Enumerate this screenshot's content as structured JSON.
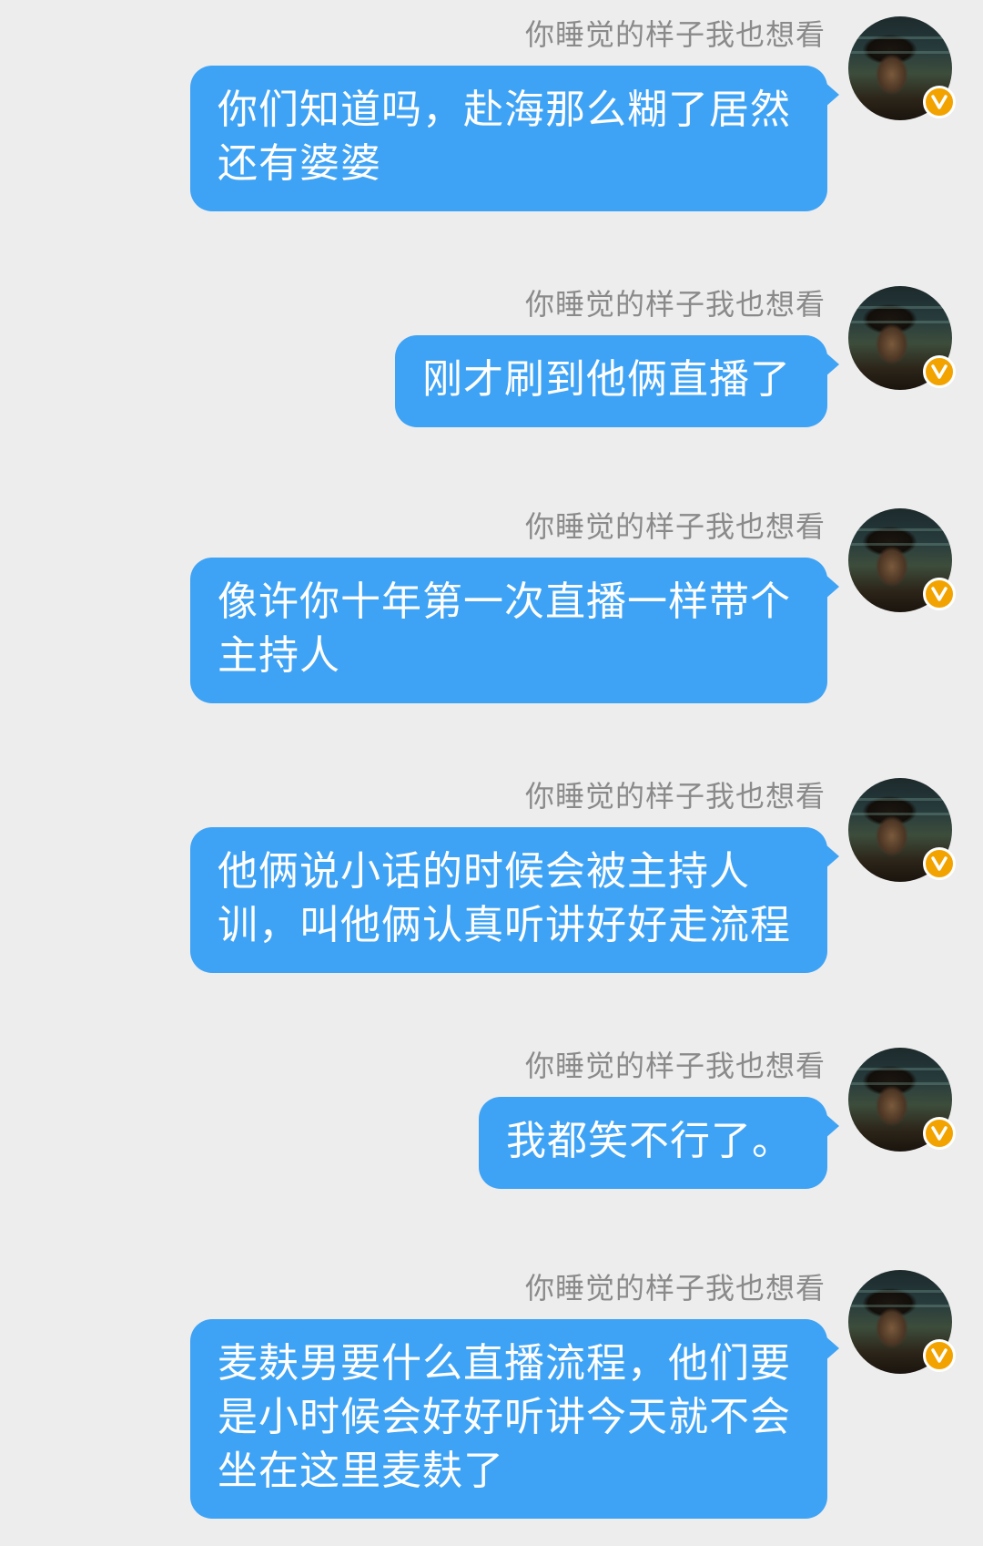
{
  "colors": {
    "background": "#ededed",
    "bubble": "#3fa3f5",
    "bubble_text": "#ffffff",
    "sender_text": "#8a8a8a",
    "verified_badge": "#f2a300"
  },
  "messages": [
    {
      "sender": "你睡觉的样子我也想看",
      "avatar_icon": "user-avatar",
      "verified_icon": "verified-v-badge-icon",
      "lines": [
        "你们知道吗，赴海那么糊了居然",
        "还有婆婆"
      ]
    },
    {
      "sender": "你睡觉的样子我也想看",
      "avatar_icon": "user-avatar",
      "verified_icon": "verified-v-badge-icon",
      "lines": [
        "刚才刷到他俩直播了"
      ]
    },
    {
      "sender": "你睡觉的样子我也想看",
      "avatar_icon": "user-avatar",
      "verified_icon": "verified-v-badge-icon",
      "lines": [
        "像许你十年第一次直播一样带个",
        "主持人"
      ]
    },
    {
      "sender": "你睡觉的样子我也想看",
      "avatar_icon": "user-avatar",
      "verified_icon": "verified-v-badge-icon",
      "lines": [
        "他俩说小话的时候会被主持人",
        "训，叫他俩认真听讲好好走流程"
      ]
    },
    {
      "sender": "你睡觉的样子我也想看",
      "avatar_icon": "user-avatar",
      "verified_icon": "verified-v-badge-icon",
      "lines": [
        "我都笑不行了。"
      ]
    },
    {
      "sender": "你睡觉的样子我也想看",
      "avatar_icon": "user-avatar",
      "verified_icon": "verified-v-badge-icon",
      "lines": [
        "麦麸男要什么直播流程，他们要",
        "是小时候会好好听讲今天就不会",
        "坐在这里麦麸了"
      ]
    }
  ]
}
